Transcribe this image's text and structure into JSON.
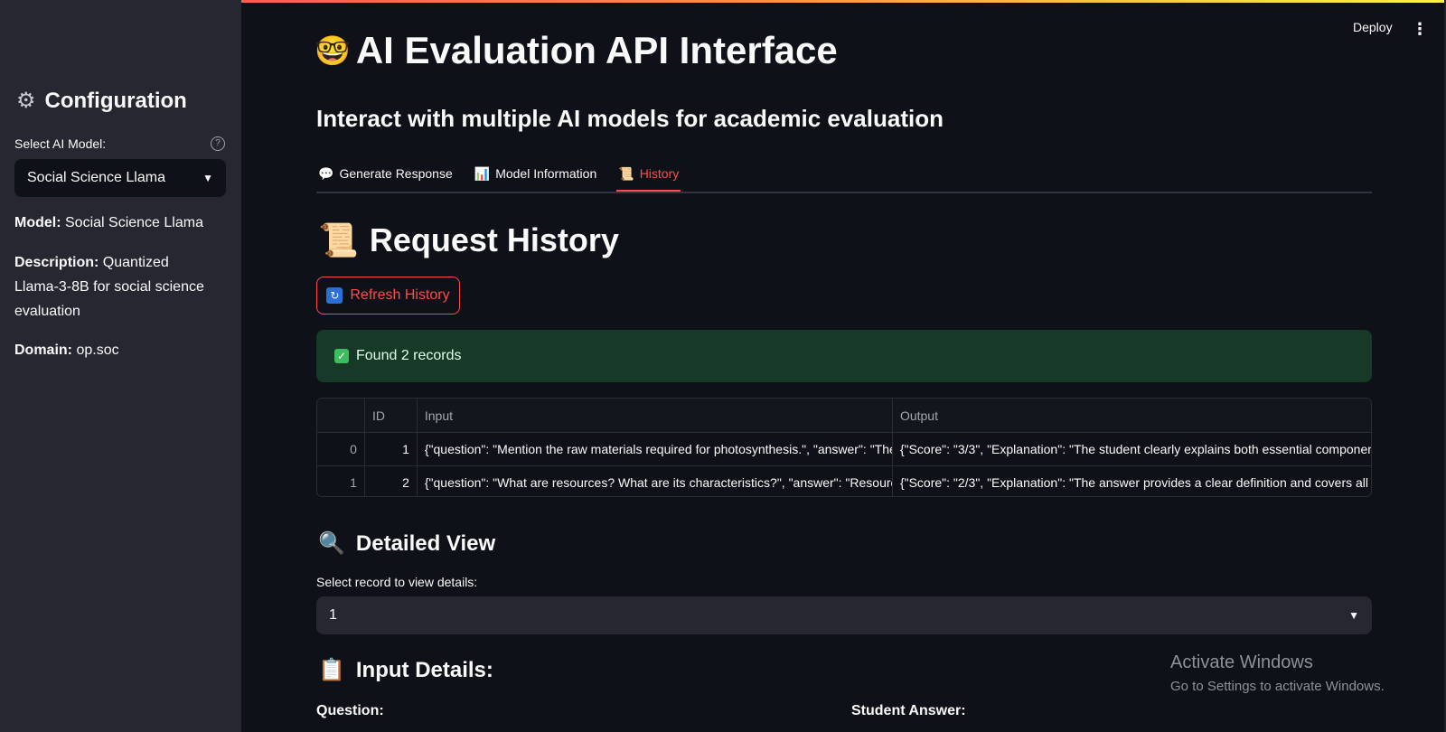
{
  "sidebar": {
    "title": "Configuration",
    "title_icon": "gear-icon",
    "select_label": "Select AI Model:",
    "selected_model": "Social Science Llama",
    "model_label": "Model:",
    "model_value": "Social Science Llama",
    "description_label": "Description:",
    "description_value": "Quantized Llama-3-8B for social science evaluation",
    "domain_label": "Domain:",
    "domain_value": "op.soc"
  },
  "header": {
    "deploy_label": "Deploy",
    "menu_icon": "⋮"
  },
  "main": {
    "title_icon": "🤓",
    "title": "AI Evaluation API Interface",
    "subtitle": "Interact with multiple AI models for academic evaluation",
    "tabs": [
      {
        "icon": "💬",
        "label": "Generate Response"
      },
      {
        "icon": "📊",
        "label": "Model Information"
      },
      {
        "icon": "📜",
        "label": "History"
      }
    ],
    "active_tab": "History",
    "history_icon": "📜",
    "history_title": "Request History",
    "refresh_label": "Refresh History",
    "success_message": "Found 2 records",
    "table": {
      "columns": [
        "",
        "ID",
        "Input",
        "Output"
      ],
      "rows": [
        {
          "index": "0",
          "id": "1",
          "input": "{\"question\": \"Mention the raw materials required for photosynthesis.\", \"answer\": \"The",
          "output": "{\"Score\": \"3/3\", \"Explanation\": \"The student clearly explains both essential componen"
        },
        {
          "index": "1",
          "id": "2",
          "input": "{\"question\": \"What are resources? What are its characteristics?\", \"answer\": \"Resources",
          "output": "{\"Score\": \"2/3\", \"Explanation\": \"The answer provides a clear definition and covers all"
        }
      ]
    },
    "detailed_icon": "🔍",
    "detailed_title": "Detailed View",
    "record_select_label": "Select record to view details:",
    "record_selected": "1",
    "input_details_icon": "📋",
    "input_details_title": "Input Details:",
    "question_label": "Question:",
    "student_answer_label": "Student Answer:"
  },
  "watermark": {
    "line1": "Activate Windows",
    "line2": "Go to Settings to activate Windows."
  },
  "colors": {
    "accent": "#ff4b4b",
    "background": "#0e1117",
    "sidebar": "#262730",
    "success_bg": "#173928"
  }
}
